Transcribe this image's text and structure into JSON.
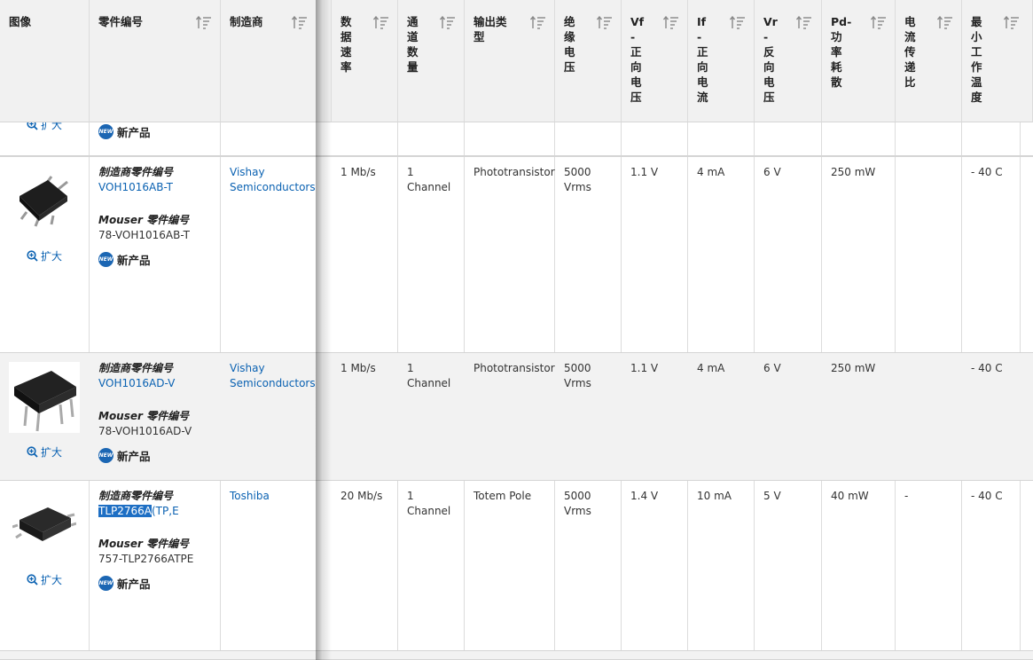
{
  "headers": {
    "image": "图像",
    "part_no": "零件编号",
    "manufacturer": "制造商",
    "data_rate": "数\n据\n速\n率",
    "channels": "通\n道\n数\n量",
    "output_type": "输出类\n型",
    "isolation": "绝\n缘\n电\n压",
    "vf": "Vf\n-\n正\n向\n电\n压",
    "if": "If\n-\n正\n向\n电\n流",
    "vr": "Vr\n-\n反\n向\n电\n压",
    "pd": "Pd-\n功\n率\n耗\n散",
    "ctr": "电\n流\n传\n递\n比",
    "min_temp": "最\n小\n工\n作\n温\n度"
  },
  "common": {
    "zoom_label": "扩大",
    "mfr_part_label": "制造商零件编号",
    "mouser_part_label": "Mouser 零件编号",
    "new_product": "新产品",
    "new_badge": "NEW"
  },
  "rows": [
    {
      "mfr_part": "VOH1016AB-T",
      "mouser_part": "78-VOH1016AB-T",
      "manufacturer": "Vishay\nSemiconductors",
      "data_rate": "1 Mb/s",
      "channels": "1\nChannel",
      "output_type": "Phototransistor",
      "isolation": "5000\nVrms",
      "vf": "1.1 V",
      "if": "4 mA",
      "vr": "6 V",
      "pd": "250 mW",
      "ctr": "",
      "min_temp": "- 40 C"
    },
    {
      "mfr_part": "VOH1016AD-V",
      "mouser_part": "78-VOH1016AD-V",
      "manufacturer": "Vishay\nSemiconductors",
      "data_rate": "1 Mb/s",
      "channels": "1\nChannel",
      "output_type": "Phototransistor",
      "isolation": "5000\nVrms",
      "vf": "1.1 V",
      "if": "4 mA",
      "vr": "6 V",
      "pd": "250 mW",
      "ctr": "",
      "min_temp": "- 40 C"
    },
    {
      "mfr_part_highlight": "TLP2766A",
      "mfr_part_rest": "(TP,E",
      "mouser_part": "757-TLP2766ATPE",
      "manufacturer": "Toshiba",
      "data_rate": "20 Mb/s",
      "channels": "1\nChannel",
      "output_type": "Totem Pole",
      "isolation": "5000\nVrms",
      "vf": "1.4 V",
      "if": "10 mA",
      "vr": "5 V",
      "pd": "40 mW",
      "ctr": "-",
      "min_temp": "- 40 C"
    }
  ],
  "colors": {
    "link": "#0b62b2",
    "header_bg": "#f1f1f1",
    "alt_row": "#f2f2f2",
    "badge": "#1b66b3"
  }
}
